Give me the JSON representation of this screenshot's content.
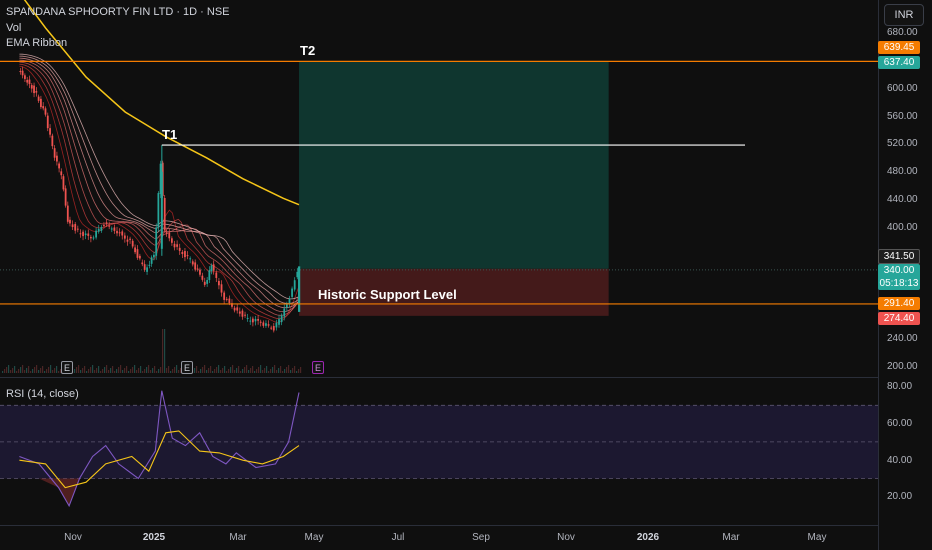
{
  "header": {
    "title": "SPANDANA SPHOORTY FIN LTD · 1D · NSE",
    "vol_label": "Vol",
    "ema_label": "EMA Ribbon"
  },
  "currency": "INR",
  "rsi_label": "RSI (14, close)",
  "price_axis_labels": [
    "680.00",
    "600.00",
    "560.00",
    "520.00",
    "480.00",
    "440.00",
    "400.00",
    "240.00",
    "200.00"
  ],
  "rsi_axis_labels": [
    "80.00",
    "60.00",
    "40.00",
    "20.00"
  ],
  "badges": {
    "t2_line": "639.45",
    "t2_price": "637.40",
    "last_close": "341.50",
    "current_price": "340.00",
    "countdown": "05:18:13",
    "support": "291.40",
    "stop": "274.40"
  },
  "time_axis": [
    "Nov",
    "2025",
    "Mar",
    "May",
    "Jul",
    "Sep",
    "Nov",
    "2026",
    "Mar",
    "May"
  ],
  "annotations": {
    "t1": "T1",
    "t2": "T2",
    "support": "Historic Support Level"
  },
  "earnings_marker": "E",
  "colors": {
    "background": "#0f0f0f",
    "up": "#26a69a",
    "down": "#ef5350",
    "sma": "#f5c518",
    "hline": "#f57c00",
    "target_zone": "#0f3b33",
    "stop_zone": "#4a1c1c",
    "rsi_line": "#7e57c2",
    "rsi_ma": "#f5c518"
  },
  "chart_data": {
    "type": "candlestick",
    "symbol": "SPANDANA SPHOORTY FIN LTD",
    "interval": "1D",
    "exchange": "NSE",
    "ylim": [
      190,
      695
    ],
    "yticks": [
      200,
      240,
      400,
      440,
      480,
      520,
      560,
      600,
      680
    ],
    "price_series": [
      {
        "date": "2024-09-20",
        "close": 625
      },
      {
        "date": "2024-09-27",
        "close": 610
      },
      {
        "date": "2024-10-04",
        "close": 590
      },
      {
        "date": "2024-10-11",
        "close": 560
      },
      {
        "date": "2024-10-18",
        "close": 500
      },
      {
        "date": "2024-10-23",
        "close": 475
      },
      {
        "date": "2024-10-28",
        "close": 410
      },
      {
        "date": "2024-11-05",
        "close": 395
      },
      {
        "date": "2024-11-15",
        "close": 385
      },
      {
        "date": "2024-11-25",
        "close": 405
      },
      {
        "date": "2024-12-05",
        "close": 395
      },
      {
        "date": "2024-12-15",
        "close": 380
      },
      {
        "date": "2024-12-26",
        "close": 340
      },
      {
        "date": "2025-01-02",
        "close": 360
      },
      {
        "date": "2025-01-07",
        "close": 490
      },
      {
        "date": "2025-01-10",
        "close": 395
      },
      {
        "date": "2025-01-20",
        "close": 370
      },
      {
        "date": "2025-01-30",
        "close": 355
      },
      {
        "date": "2025-02-10",
        "close": 320
      },
      {
        "date": "2025-02-15",
        "close": 345
      },
      {
        "date": "2025-02-25",
        "close": 300
      },
      {
        "date": "2025-03-05",
        "close": 285
      },
      {
        "date": "2025-03-15",
        "close": 270
      },
      {
        "date": "2025-03-25",
        "close": 265
      },
      {
        "date": "2025-04-04",
        "close": 255
      },
      {
        "date": "2025-04-10",
        "close": 275
      },
      {
        "date": "2025-04-16",
        "close": 300
      },
      {
        "date": "2025-04-22",
        "close": 340
      }
    ],
    "sma_series": [
      {
        "date": "2024-09-10",
        "value": 760
      },
      {
        "date": "2024-10-10",
        "value": 685
      },
      {
        "date": "2024-11-10",
        "value": 615
      },
      {
        "date": "2024-12-10",
        "value": 565
      },
      {
        "date": "2025-01-10",
        "value": 530
      },
      {
        "date": "2025-02-10",
        "value": 500
      },
      {
        "date": "2025-03-10",
        "value": 470
      },
      {
        "date": "2025-04-10",
        "value": 442
      },
      {
        "date": "2025-04-22",
        "value": 433
      }
    ],
    "levels": {
      "T1": 518,
      "T2": 637.4,
      "support": 291.4,
      "stop": 274.4,
      "current": 340.0
    },
    "position": {
      "entry": 341.5,
      "target": 637.4,
      "stop": 274.4,
      "start": "2025-04-22",
      "end": "2025-12-15"
    },
    "rsi": {
      "period": 14,
      "ylim": [
        5,
        85
      ],
      "bands": [
        30,
        50,
        70
      ],
      "series": [
        {
          "date": "2024-09-20",
          "value": 42
        },
        {
          "date": "2024-10-05",
          "value": 38
        },
        {
          "date": "2024-10-20",
          "value": 25
        },
        {
          "date": "2024-10-28",
          "value": 15
        },
        {
          "date": "2024-11-05",
          "value": 30
        },
        {
          "date": "2024-11-15",
          "value": 42
        },
        {
          "date": "2024-11-25",
          "value": 48
        },
        {
          "date": "2024-12-05",
          "value": 38
        },
        {
          "date": "2024-12-20",
          "value": 30
        },
        {
          "date": "2025-01-02",
          "value": 45
        },
        {
          "date": "2025-01-07",
          "value": 78
        },
        {
          "date": "2025-01-15",
          "value": 52
        },
        {
          "date": "2025-01-25",
          "value": 48
        },
        {
          "date": "2025-02-05",
          "value": 55
        },
        {
          "date": "2025-02-15",
          "value": 42
        },
        {
          "date": "2025-02-25",
          "value": 38
        },
        {
          "date": "2025-03-05",
          "value": 44
        },
        {
          "date": "2025-03-20",
          "value": 36
        },
        {
          "date": "2025-04-04",
          "value": 38
        },
        {
          "date": "2025-04-14",
          "value": 50
        },
        {
          "date": "2025-04-22",
          "value": 77
        }
      ],
      "ma_series": [
        {
          "date": "2024-09-20",
          "value": 40
        },
        {
          "date": "2024-10-10",
          "value": 38
        },
        {
          "date": "2024-10-25",
          "value": 25
        },
        {
          "date": "2024-11-10",
          "value": 28
        },
        {
          "date": "2024-11-25",
          "value": 38
        },
        {
          "date": "2024-12-15",
          "value": 42
        },
        {
          "date": "2024-12-28",
          "value": 34
        },
        {
          "date": "2025-01-10",
          "value": 55
        },
        {
          "date": "2025-01-20",
          "value": 56
        },
        {
          "date": "2025-02-05",
          "value": 45
        },
        {
          "date": "2025-02-20",
          "value": 44
        },
        {
          "date": "2025-03-10",
          "value": 40
        },
        {
          "date": "2025-03-25",
          "value": 38
        },
        {
          "date": "2025-04-10",
          "value": 42
        },
        {
          "date": "2025-04-22",
          "value": 48
        }
      ]
    }
  }
}
